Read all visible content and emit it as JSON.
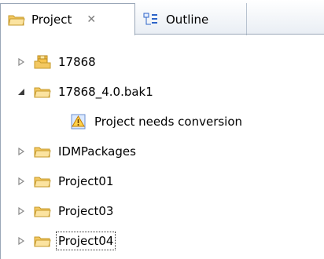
{
  "tabs": [
    {
      "label": "Project",
      "icon": "folder-open-icon",
      "active": true,
      "close_glyph": "✕"
    },
    {
      "label": "Outline",
      "icon": "outline-icon",
      "active": false
    }
  ],
  "tree": {
    "items": [
      {
        "label": "17868",
        "expanded": false,
        "icon": "project-package-icon"
      },
      {
        "label": "17868_4.0.bak1",
        "expanded": true,
        "icon": "folder-open-icon"
      },
      {
        "label": "Project needs conversion",
        "icon": "warning-conversion-icon",
        "child": true
      },
      {
        "label": "IDMPackages",
        "expanded": false,
        "icon": "folder-open-icon"
      },
      {
        "label": "Project01",
        "expanded": false,
        "icon": "folder-open-icon"
      },
      {
        "label": "Project03",
        "expanded": false,
        "icon": "folder-open-icon"
      },
      {
        "label": "Project04",
        "expanded": false,
        "icon": "folder-open-icon",
        "selected_focus": true
      }
    ]
  },
  "colors": {
    "folder_fill": "#f6d27a",
    "folder_stroke": "#c69a2b",
    "tab_border": "#9aa7b8"
  }
}
